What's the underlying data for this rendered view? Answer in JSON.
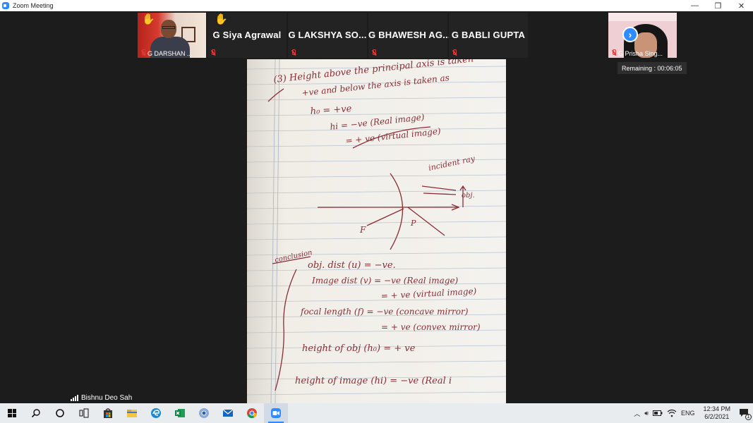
{
  "window": {
    "title": "Zoom Meeting",
    "minimize_glyph": "—",
    "restore_glyph": "❐",
    "close_glyph": "✕"
  },
  "participants": [
    {
      "name": "G DARSHAN ...",
      "type": "video",
      "muted": true,
      "hand_raised": true
    },
    {
      "name": "G Siya Agrawal",
      "type": "name",
      "muted": true,
      "hand_raised": true
    },
    {
      "name": "G LAKSHYA SO...",
      "type": "name",
      "muted": true,
      "hand_raised": false
    },
    {
      "name": "G BHAWESH AG...",
      "type": "name",
      "muted": true,
      "hand_raised": false
    },
    {
      "name": "G BABLI GUPTA",
      "type": "name",
      "muted": true,
      "hand_raised": false
    },
    {
      "name": "G Prisha Sing...",
      "type": "video",
      "muted": true,
      "hand_raised": false
    }
  ],
  "next_page_icon": "chevron-right-icon",
  "remaining": "Remaining : 00:06:05",
  "active_speaker": "Bishnu Deo Sah",
  "notes": {
    "line1": "(3) Height above the principal axis is taken",
    "line2": "+ve and below the axis is taken as",
    "line3": "h₀ = +ve",
    "line4": "hi = −ve (Real image)",
    "line5": "= + ve (virtual image)",
    "diag_label1": "incident ray",
    "diag_label2": "obj.",
    "diag_label3": "P",
    "diag_label4": "F",
    "conclusion": "conclusion",
    "c1": "obj. dist (u) = −ve.",
    "c2": "Image dist (v) = −ve (Real image)",
    "c3": "= + ve (virtual image)",
    "c4": "focal length (f) = −ve (concave mirror)",
    "c5": "= + ve (convex mirror)",
    "c6": "height of obj (h₀) = + ve",
    "c7": "height of image (hi) = −ve (Real i"
  },
  "taskbar": {
    "time": "12:34 PM",
    "date": "6/2/2021",
    "language": "ENG",
    "apps": [
      "start",
      "search",
      "cortana",
      "task-view",
      "store",
      "file-explorer",
      "edge",
      "excel",
      "chrome-canary",
      "mail",
      "chrome",
      "zoom"
    ],
    "notification_count": "1"
  }
}
